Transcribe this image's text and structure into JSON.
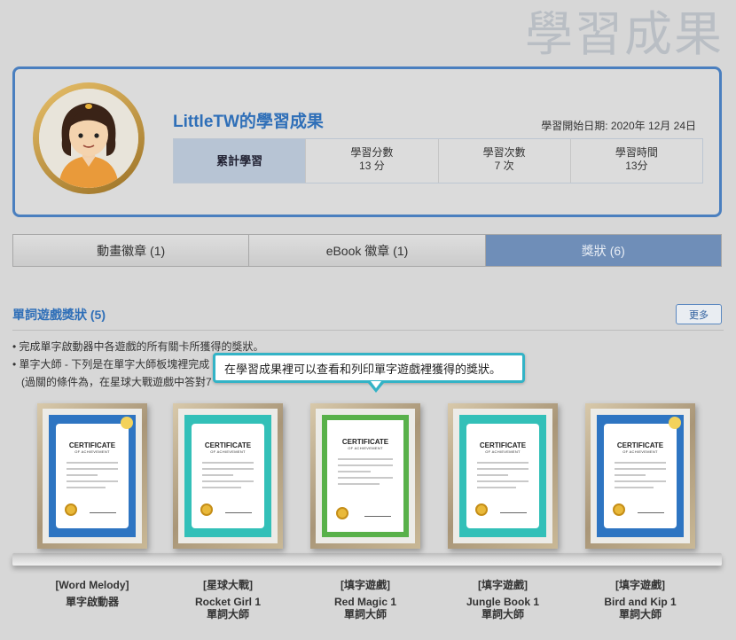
{
  "page": {
    "title": "學習成果"
  },
  "profile": {
    "name": "LittleTW的學習成果",
    "start_date": "學習開始日期: 2020年 12月 24日",
    "stats": [
      {
        "label": "累計學習"
      },
      {
        "label": "學習分數",
        "value": "13 分"
      },
      {
        "label": "學習次數",
        "value": "7 次"
      },
      {
        "label": "學習時間",
        "value": "13分"
      }
    ]
  },
  "tabs": [
    {
      "label": "動畫徽章 (1)",
      "active": false
    },
    {
      "label": "eBook 徽章 (1)",
      "active": false
    },
    {
      "label": "獎狀 (6)",
      "active": true
    }
  ],
  "section": {
    "title": "單詞遊戲獎狀 (5)",
    "more_label": "更多",
    "bullets": [
      "• 完成單字啟動器中各遊戲的所有關卡所獲得的獎狀。",
      "• 單字大師 - 下列是在單字大師板塊裡完成",
      "(過關的條件為，在星球大戰遊戲中答對7"
    ]
  },
  "tooltip": {
    "text": "在學習成果裡可以查看和列印單字遊戲裡獲得的獎狀。"
  },
  "certificates": [
    {
      "category": "[Word Melody]",
      "name": "單字啟動器",
      "subtitle": "",
      "color": "#2e75c2"
    },
    {
      "category": "[星球大戰]",
      "name": "Rocket Girl 1",
      "subtitle": "單詞大師",
      "color": "#33c0b8"
    },
    {
      "category": "[填字遊戲]",
      "name": "Red Magic 1",
      "subtitle": "單詞大師",
      "color": "#59b14a"
    },
    {
      "category": "[填字遊戲]",
      "name": "Jungle Book 1",
      "subtitle": "單詞大師",
      "color": "#33c0b8"
    },
    {
      "category": "[填字遊戲]",
      "name": "Bird and Kip 1",
      "subtitle": "單詞大師",
      "color": "#2e75c2"
    }
  ],
  "certificate_text": {
    "heading": "CERTIFICATE",
    "sub": "OF ACHIEVEMENT"
  }
}
